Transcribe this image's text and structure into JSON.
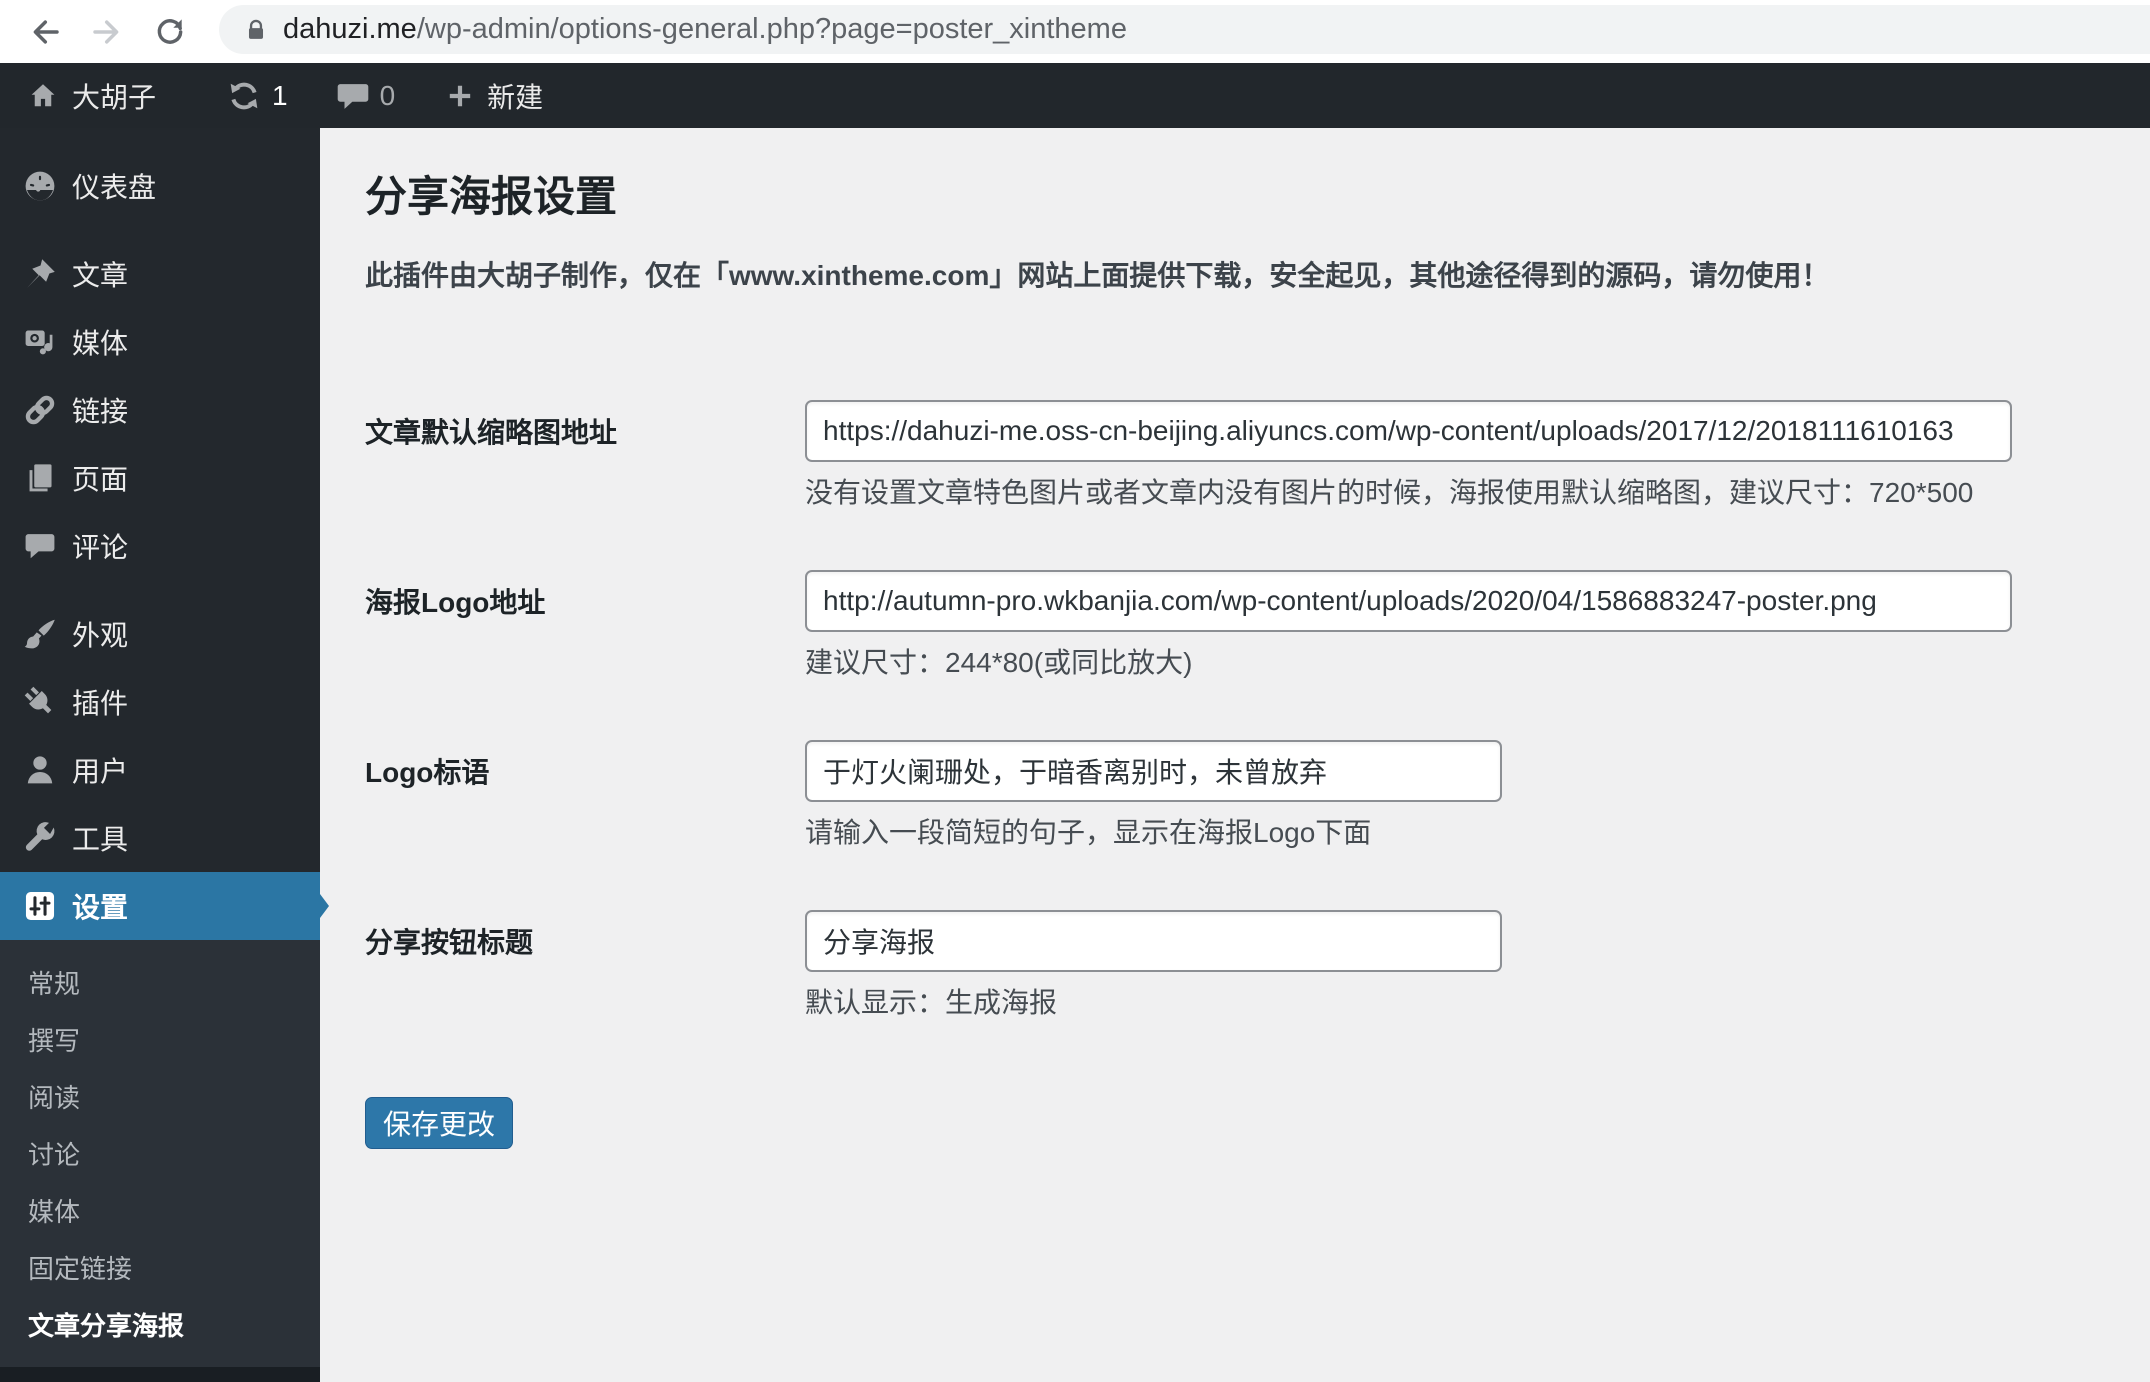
{
  "browser": {
    "url_domain": "dahuzi.me",
    "url_path": "/wp-admin/options-general.php?page=poster_xintheme"
  },
  "admin_bar": {
    "site_name": "大胡子",
    "update_count": "1",
    "comment_count": "0",
    "new_label": "新建"
  },
  "sidebar": {
    "items": [
      {
        "label": "仪表盘"
      },
      {
        "label": "文章"
      },
      {
        "label": "媒体"
      },
      {
        "label": "链接"
      },
      {
        "label": "页面"
      },
      {
        "label": "评论"
      },
      {
        "label": "外观"
      },
      {
        "label": "插件"
      },
      {
        "label": "用户"
      },
      {
        "label": "工具"
      },
      {
        "label": "设置",
        "active": true
      }
    ],
    "submenu": [
      {
        "label": "常规"
      },
      {
        "label": "撰写"
      },
      {
        "label": "阅读"
      },
      {
        "label": "讨论"
      },
      {
        "label": "媒体"
      },
      {
        "label": "固定链接"
      },
      {
        "label": "文章分享海报",
        "current": true
      }
    ]
  },
  "main": {
    "title": "分享海报设置",
    "notice": "此插件由大胡子制作，仅在「www.xintheme.com」网站上面提供下载，安全起见，其他途径得到的源码，请勿使用！",
    "fields": [
      {
        "label": "文章默认缩略图地址",
        "value": "https://dahuzi-me.oss-cn-beijing.aliyuncs.com/wp-content/uploads/2017/12/2018111610163",
        "help": "没有设置文章特色图片或者文章内没有图片的时候，海报使用默认缩略图，建议尺寸：720*500"
      },
      {
        "label": "海报Logo地址",
        "value": "http://autumn-pro.wkbanjia.com/wp-content/uploads/2020/04/1586883247-poster.png",
        "help": "建议尺寸：244*80(或同比放大)"
      },
      {
        "label": "Logo标语",
        "value": "于灯火阑珊处，于暗香离别时，未曾放弃",
        "help": "请输入一段简短的句子，显示在海报Logo下面"
      },
      {
        "label": "分享按钮标题",
        "value": "分享海报",
        "help": "默认显示：生成海报"
      }
    ],
    "save_label": "保存更改"
  },
  "colors": {
    "accent_blue": "#2b76a4",
    "button_blue": "#2d77a9",
    "sidebar_bg": "#23282d",
    "submenu_bg": "#2b3138",
    "admin_bar_bg": "#22272c",
    "content_bg": "#f0f0f1",
    "input_border": "#8c8f94"
  }
}
